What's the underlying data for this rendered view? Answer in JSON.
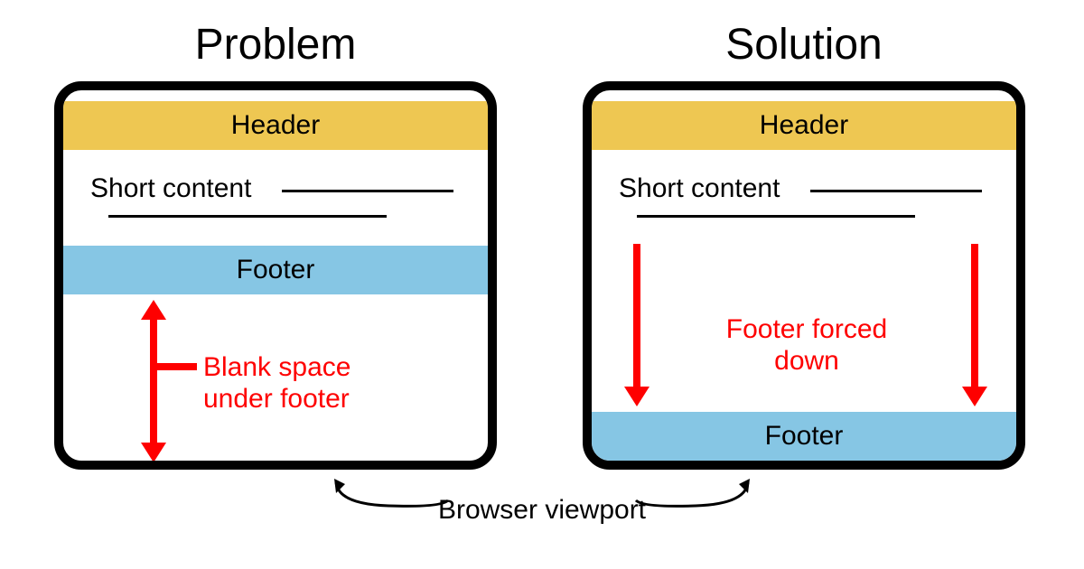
{
  "titles": {
    "problem": "Problem",
    "solution": "Solution"
  },
  "labels": {
    "header": "Header",
    "footer": "Footer",
    "content": "Short content",
    "viewport": "Browser viewport"
  },
  "annotations": {
    "blank_space": "Blank space\nunder footer",
    "forced_down": "Footer forced down"
  },
  "colors": {
    "header_bg": "#eec752",
    "footer_bg": "#86c6e4",
    "annotation": "#fe0000",
    "frame": "#000000"
  }
}
